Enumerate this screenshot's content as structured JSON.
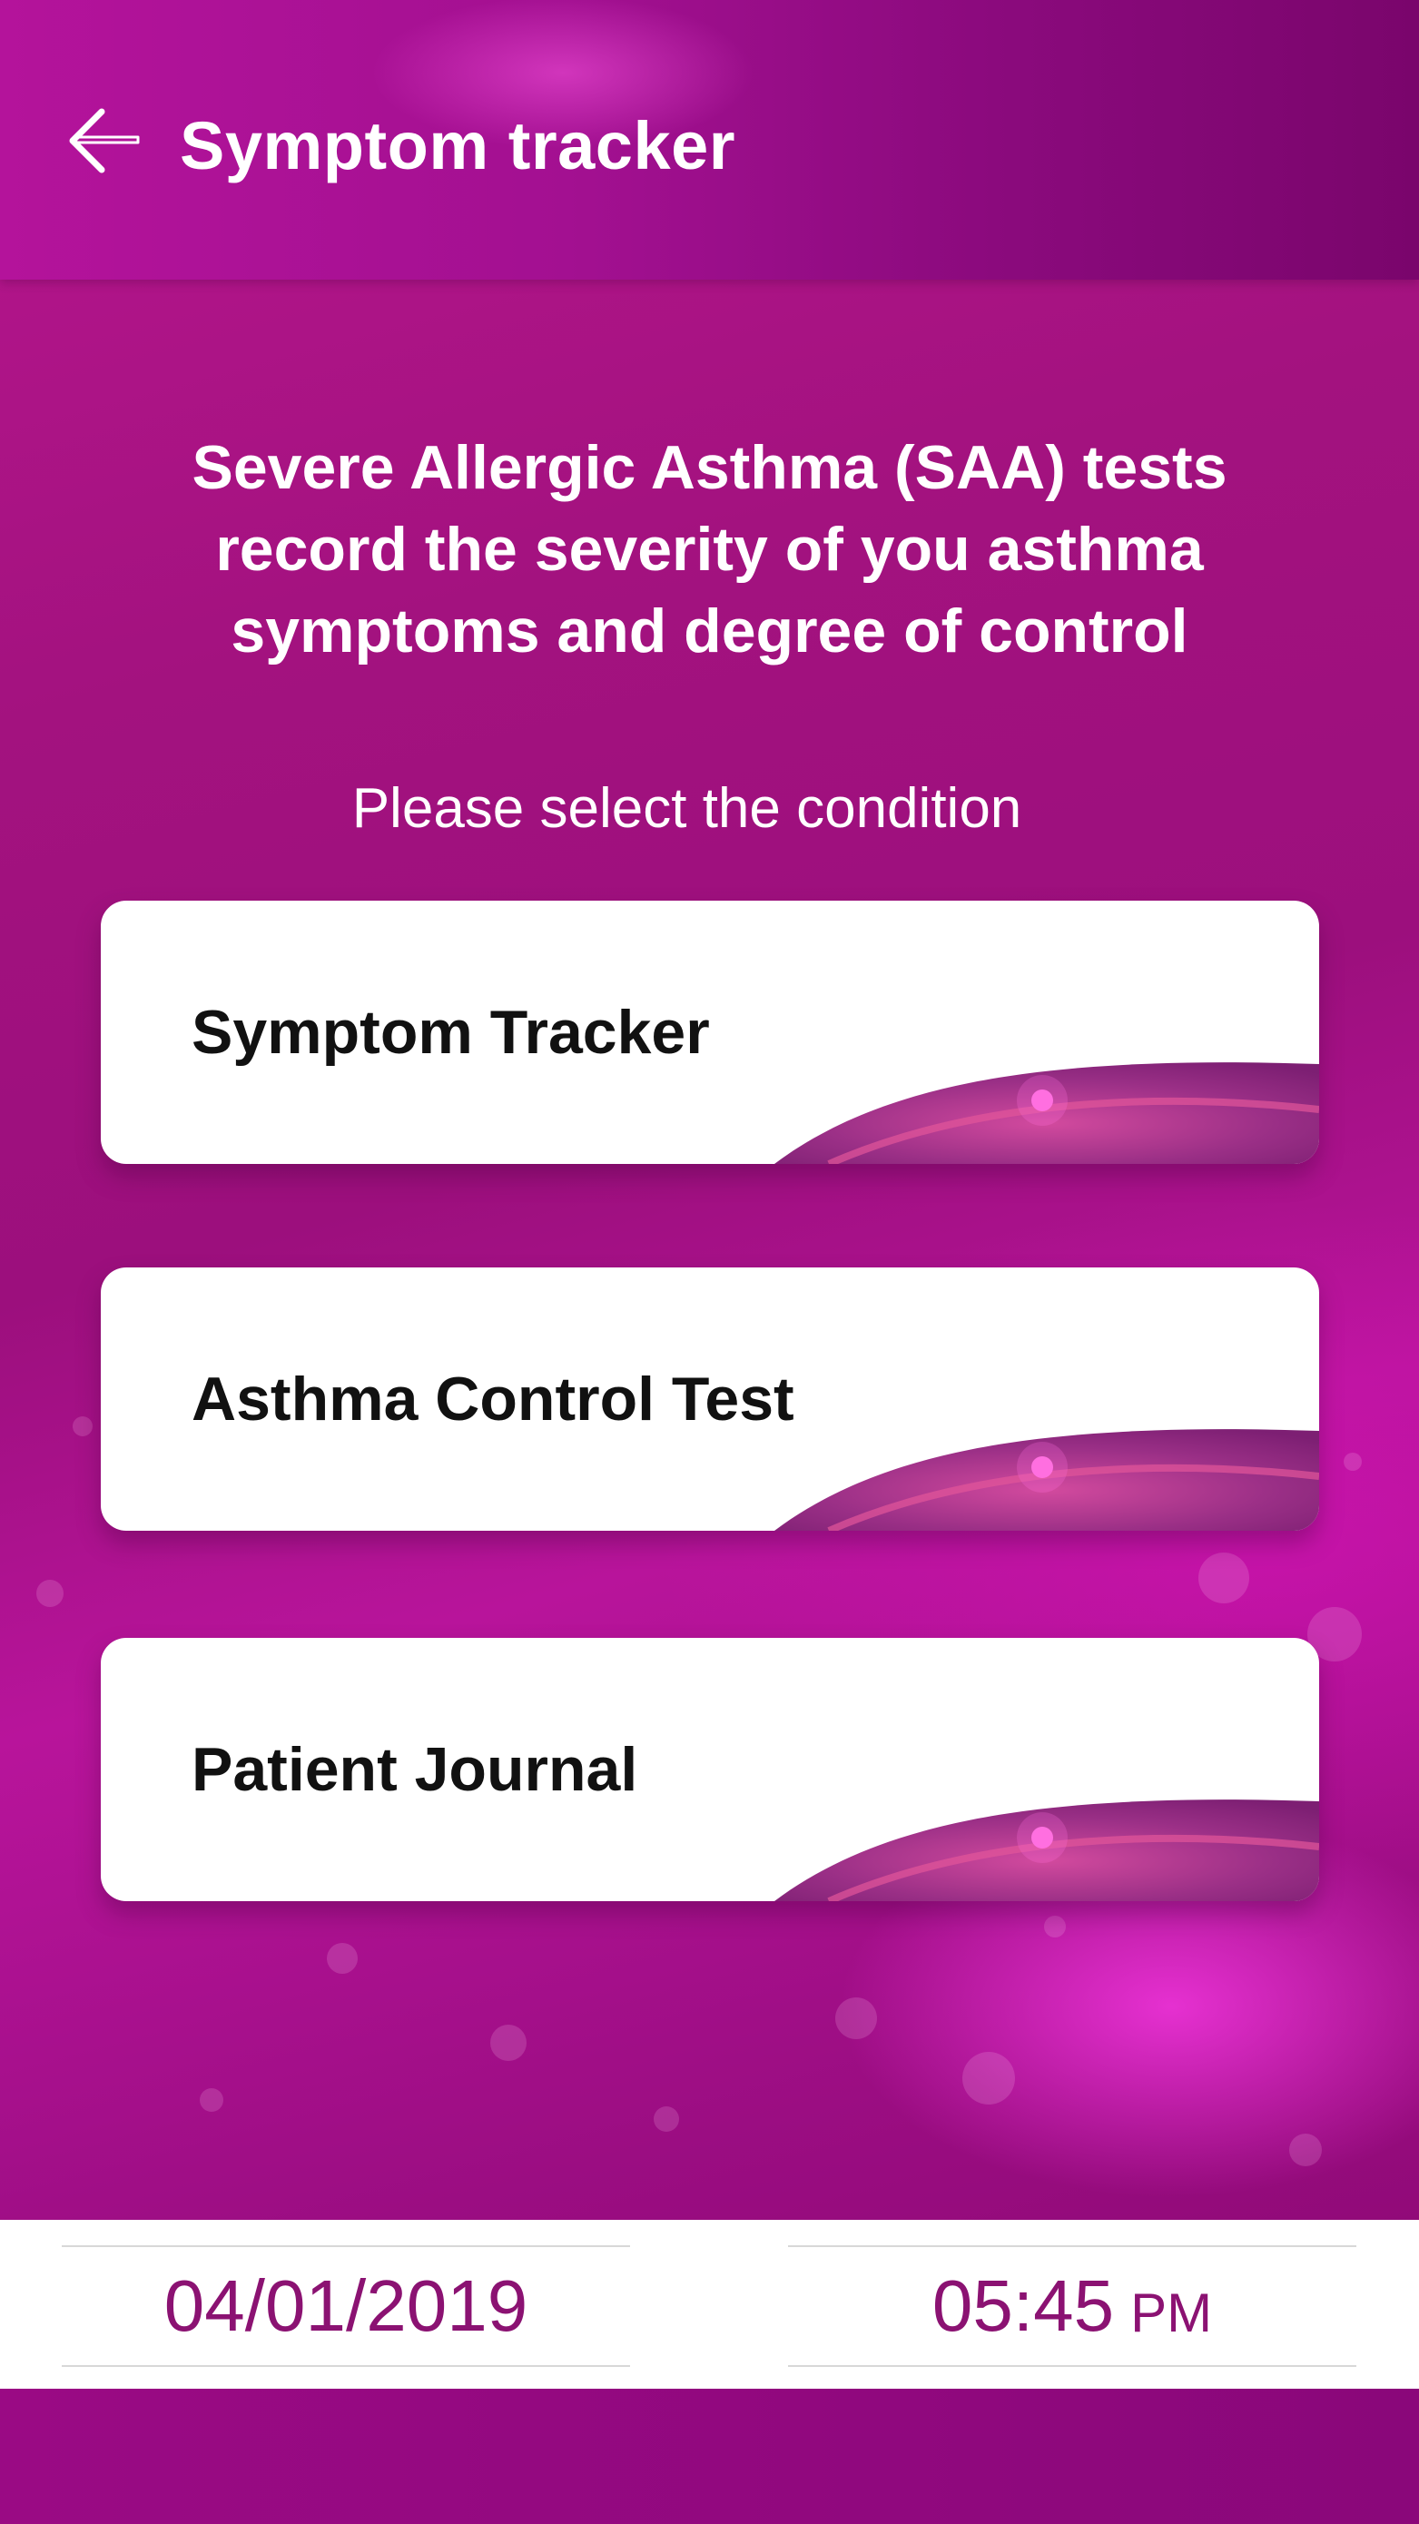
{
  "header": {
    "title": "Symptom tracker",
    "back_icon": "arrow-left-icon"
  },
  "intro": {
    "text": "Severe Allergic Asthma (SAA) tests\nrecord the severity of you asthma\nsymptoms and degree of control"
  },
  "prompt": "Please select the condition",
  "options": [
    {
      "label": "Symptom Tracker"
    },
    {
      "label": "Asthma Control Test"
    },
    {
      "label": "Patient Journal"
    }
  ],
  "footer": {
    "date": "04/01/2019",
    "time": "05:45",
    "ampm": "PM"
  },
  "colors": {
    "accent": "#a3127f",
    "date_text": "#8b1272",
    "card_bg": "#ffffff"
  }
}
